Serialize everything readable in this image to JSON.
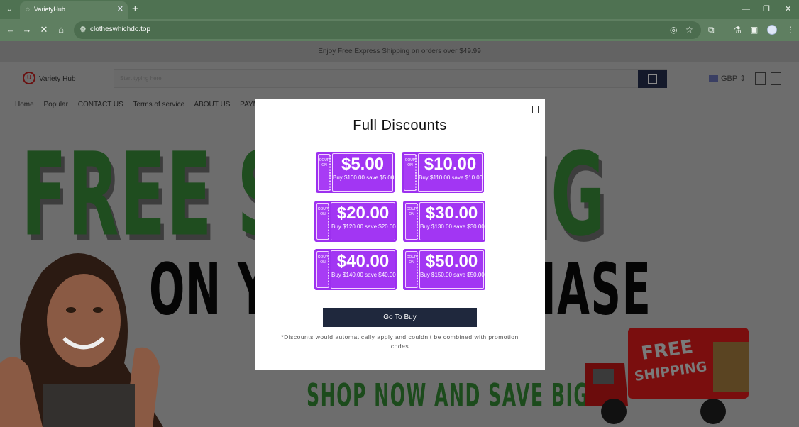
{
  "browser": {
    "tab_title": "VarietyHub",
    "url": "clotheswhichdo.top"
  },
  "site": {
    "announcement": "Enjoy Free Express Shipping on orders over $49.99",
    "logo_text": "Variety Hub",
    "search_placeholder": "Start typing here",
    "currency": "GBP",
    "nav": [
      "Home",
      "Popular",
      "CONTACT US",
      "Terms of service",
      "ABOUT US",
      "PAYMENT POLI"
    ]
  },
  "hero": {
    "line1": "FREE SHIPPING",
    "line2": "ON YOUR PURCHASE",
    "line3": "SHOP NOW AND SAVE BIG!",
    "truck_text": "FREE SHIPPING"
  },
  "modal": {
    "title": "Full Discounts",
    "coupon_stub_label": "COUPON",
    "coupons": [
      {
        "amount": "$5.00",
        "desc": "Buy $100.00 save $5.00"
      },
      {
        "amount": "$10.00",
        "desc": "Buy $110.00 save $10.00"
      },
      {
        "amount": "$20.00",
        "desc": "Buy $120.00 save $20.00"
      },
      {
        "amount": "$30.00",
        "desc": "Buy $130.00 save $30.00"
      },
      {
        "amount": "$40.00",
        "desc": "Buy $140.00 save $40.00"
      },
      {
        "amount": "$50.00",
        "desc": "Buy $150.00 save $50.00"
      }
    ],
    "cta": "Go To Buy",
    "disclaimer": "*Discounts would automatically apply and couldn't be combined with promotion codes"
  },
  "colors": {
    "chrome": "#5f7f61",
    "coupon": "#9c30ef",
    "cta": "#1f283d"
  }
}
